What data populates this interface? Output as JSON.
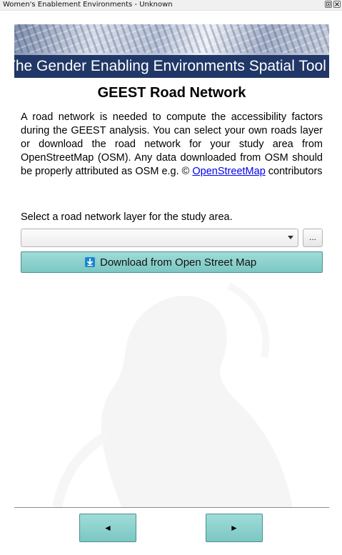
{
  "window": {
    "title": "Women's Enablement Environments - Unknown",
    "float_icon": "float-window-icon",
    "close_icon": "close-icon"
  },
  "banner": {
    "text": "The Gender Enabling Environments Spatial Tool"
  },
  "page": {
    "heading": "GEEST Road Network",
    "description_before_link": "A road network is needed to compute the accessibility factors during the GEEST analysis. You can select your own roads layer or download the road network for your study area from OpenStreetMap (OSM). Any data downloaded from OSM should be properly attributed as OSM e.g. © ",
    "link_text": "OpenStreetMap",
    "description_after_link": " contributors",
    "select_label": "Select a road network layer for the study area."
  },
  "controls": {
    "layer_combo_value": "",
    "browse_label": "...",
    "download_label": "Download from Open Street Map",
    "download_icon": "download-arrow-icon"
  },
  "navigation": {
    "prev_glyph": "◄",
    "next_glyph": "►"
  },
  "colors": {
    "banner_bar": "#203767",
    "button_teal": "#8fd3cf",
    "link": "#0000ee",
    "download_icon_bg": "#1a86d0"
  }
}
